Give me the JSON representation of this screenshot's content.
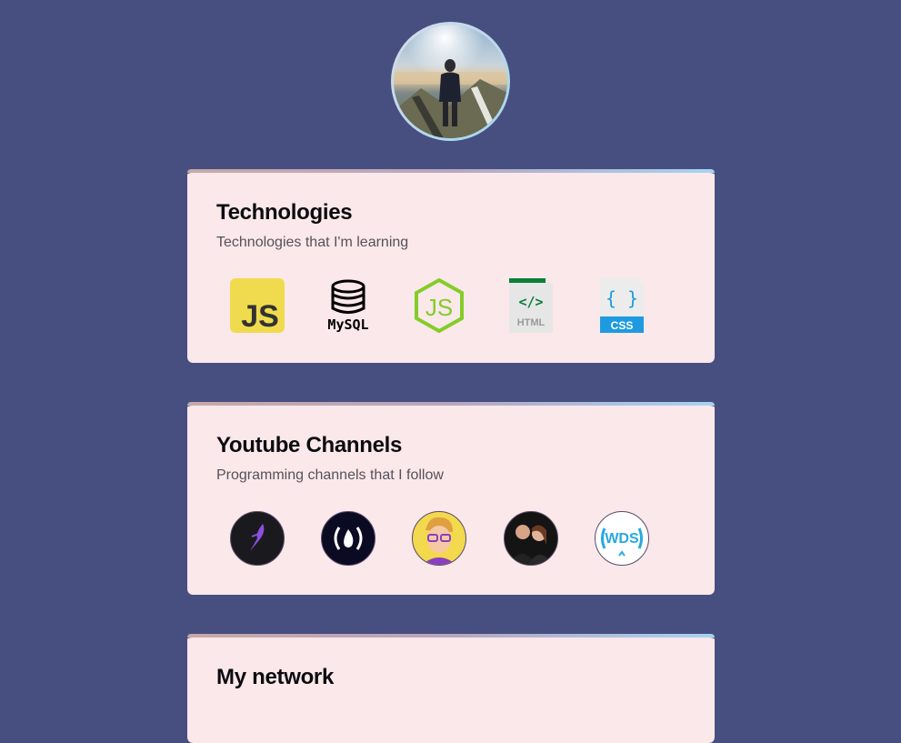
{
  "profile": {
    "avatar_alt": "profile-photo"
  },
  "sections": [
    {
      "title": "Technologies",
      "subtitle": "Technologies that I'm learning",
      "icons": [
        {
          "name": "javascript-icon",
          "label": "JS"
        },
        {
          "name": "mysql-icon",
          "label": "MySQL"
        },
        {
          "name": "nodejs-icon",
          "label": "JS"
        },
        {
          "name": "html-icon",
          "label": "HTML"
        },
        {
          "name": "css-icon",
          "label": "CSS"
        }
      ]
    },
    {
      "title": "Youtube Channels",
      "subtitle": "Programming channels that I follow",
      "icons": [
        {
          "name": "channel-feather-icon"
        },
        {
          "name": "channel-freecodecamp-icon"
        },
        {
          "name": "channel-cartoon-avatar-icon"
        },
        {
          "name": "channel-duo-avatar-icon"
        },
        {
          "name": "channel-wds-icon",
          "label": "WDS"
        }
      ]
    },
    {
      "title": "My network"
    }
  ],
  "colors": {
    "background": "#474f80",
    "card": "#fbe8ea",
    "js_yellow": "#f0db4f",
    "node_green": "#83cd29",
    "html_green": "#0c7d3a",
    "css_blue": "#1572b6"
  }
}
